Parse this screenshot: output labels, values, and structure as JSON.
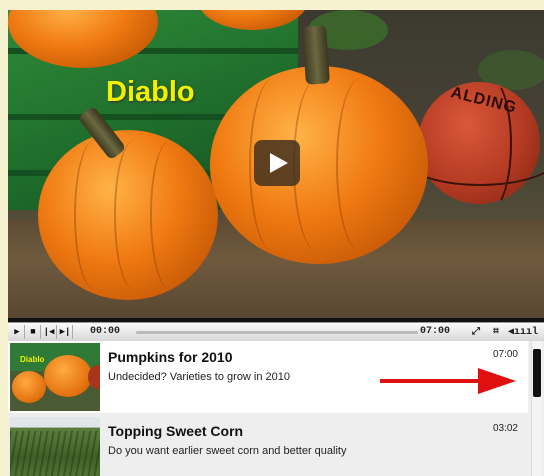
{
  "video": {
    "overlay_title": "Diablo",
    "ball_text": "ALDING"
  },
  "controls": {
    "current_time": "00:00",
    "total_time": "07:00",
    "progress": 0.0
  },
  "playlist": {
    "items": [
      {
        "title": "Pumpkins for 2010",
        "description": "Undecided? Varieties to grow in 2010",
        "duration": "07:00",
        "thumb_label": "Diablo"
      },
      {
        "title": "Topping Sweet Corn",
        "description": "Do you want earlier sweet corn and better quality",
        "duration": "03:02"
      }
    ]
  },
  "colors": {
    "overlay_text": "#f0f000",
    "annotation_arrow": "#e01010",
    "scroll_thumb": "#111111"
  }
}
